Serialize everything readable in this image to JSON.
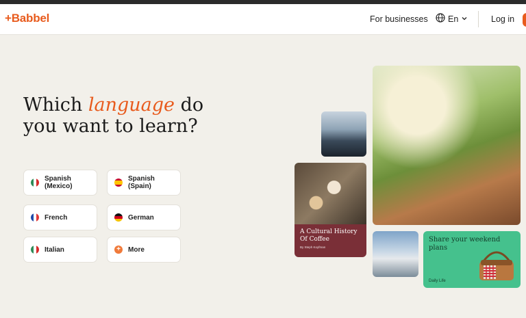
{
  "header": {
    "logo": "+Babbel",
    "for_businesses": "For businesses",
    "language_label": "En",
    "login": "Log in"
  },
  "hero": {
    "title_pre": "Which ",
    "title_accent": "language",
    "title_post": " do you want to learn?"
  },
  "languages": [
    {
      "label_line1": "Spanish",
      "label_line2": "(Mexico)",
      "flag": "mexico-flag"
    },
    {
      "label_line1": "Spanish",
      "label_line2": "(Spain)",
      "flag": "spain-flag"
    },
    {
      "label_line1": "French",
      "flag": "france-flag"
    },
    {
      "label_line1": "German",
      "flag": "germany-flag"
    },
    {
      "label_line1": "Italian",
      "flag": "italy-flag"
    },
    {
      "label_line1": "More",
      "flag": "plus-icon"
    }
  ],
  "cards": {
    "coffee_title": "A Cultural History Of Coffee",
    "coffee_author": "By Steph Koyfman",
    "weekend_title": "Share your weekend plans",
    "weekend_tag": "Daily Life"
  },
  "colors": {
    "accent": "#e85b1d",
    "background": "#f2f0ea",
    "coffee_card": "#7a2f37",
    "green_card": "#45c18d"
  }
}
